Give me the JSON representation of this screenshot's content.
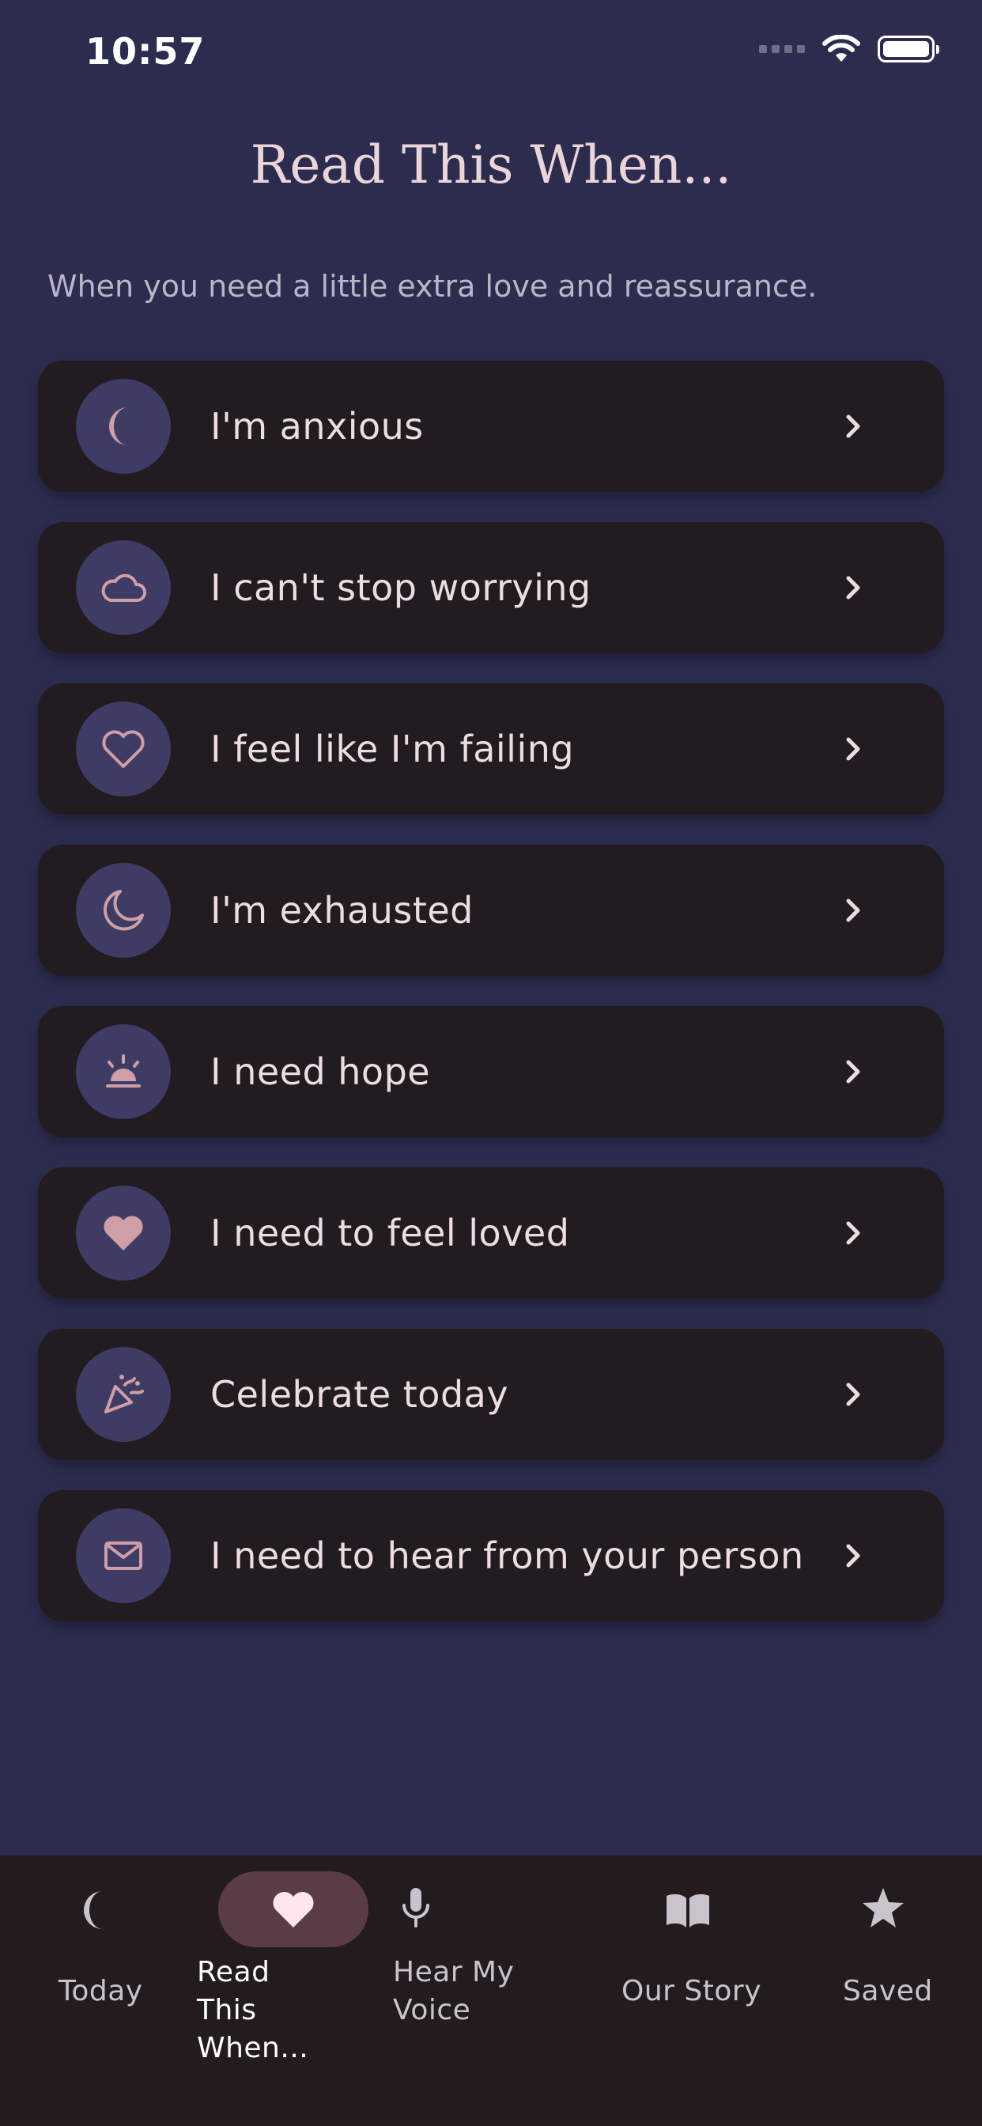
{
  "status_bar": {
    "time": "10:57"
  },
  "header": {
    "title": "Read This When...",
    "subtitle": "When you need a little extra love and reassurance."
  },
  "items": [
    {
      "label": "I'm anxious",
      "icon": "crescent-moon-filled-icon"
    },
    {
      "label": "I can't stop worrying",
      "icon": "cloud-icon"
    },
    {
      "label": "I feel like I'm failing",
      "icon": "heart-outline-icon"
    },
    {
      "label": "I'm exhausted",
      "icon": "moon-outline-icon"
    },
    {
      "label": "I need hope",
      "icon": "sunrise-icon"
    },
    {
      "label": "I need to feel loved",
      "icon": "heart-filled-icon"
    },
    {
      "label": "Celebrate today",
      "icon": "party-popper-icon"
    },
    {
      "label": "I need to hear from your person",
      "icon": "envelope-icon"
    }
  ],
  "tab_bar": {
    "tabs": [
      {
        "label": "Today",
        "icon": "moon-icon",
        "active": false
      },
      {
        "label": "Read This When...",
        "icon": "heart-icon",
        "active": true
      },
      {
        "label": "Hear My Voice",
        "icon": "microphone-icon",
        "active": false
      },
      {
        "label": "Our Story",
        "icon": "book-icon",
        "active": false
      },
      {
        "label": "Saved",
        "icon": "star-icon",
        "active": false
      }
    ]
  },
  "colors": {
    "background": "#2c2c4e",
    "card": "#221b1f",
    "icon_circle": "#3e3b65",
    "icon_accent": "#cf9ea6",
    "tab_bar": "#231b1e",
    "active_pill": "#5a3c44"
  }
}
